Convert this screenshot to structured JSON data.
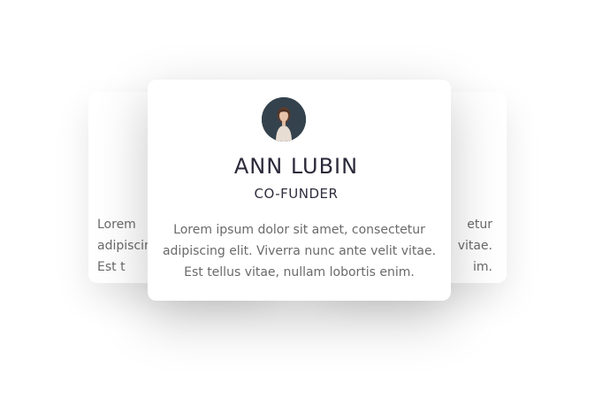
{
  "front_card": {
    "name": "ANN LUBIN",
    "role": "CO-FUNDER",
    "quote_lines": [
      "Lorem ipsum dolor sit amet, consectetur",
      "adipiscing elit. Viverra nunc ante velit vitae.",
      "Est tellus vitae, nullam lobortis enim."
    ],
    "avatar_icon": "person-portrait-icon"
  },
  "left_card": {
    "quote_lines": [
      "Lorem",
      "adipiscin",
      "Est t"
    ]
  },
  "right_card": {
    "quote_lines": [
      "etur",
      "vitae.",
      "im."
    ]
  }
}
